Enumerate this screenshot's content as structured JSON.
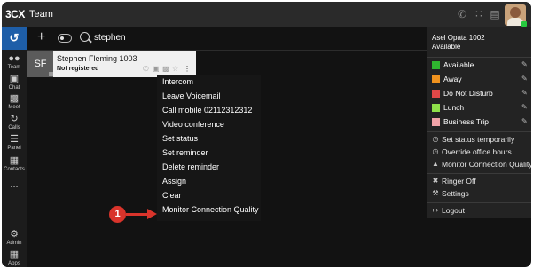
{
  "window": {
    "logo": "3CX",
    "title": "Team"
  },
  "sidebar": {
    "items": [
      {
        "label": "Team",
        "icon": "people-icon"
      },
      {
        "label": "Chat",
        "icon": "chat-icon"
      },
      {
        "label": "Meet",
        "icon": "video-icon"
      },
      {
        "label": "Calls",
        "icon": "history-icon"
      },
      {
        "label": "Panel",
        "icon": "panel-icon"
      },
      {
        "label": "Contacts",
        "icon": "contacts-icon"
      },
      {
        "label": "...",
        "icon": "more-icon"
      },
      {
        "label": "Admin",
        "icon": "gear-icon"
      },
      {
        "label": "Apps",
        "icon": "apps-icon"
      }
    ]
  },
  "search": {
    "value": "stephen"
  },
  "contact": {
    "initials": "SF",
    "name": "Stephen Fleming 1003",
    "status": "Not registered"
  },
  "context_menu": {
    "items": [
      "Intercom",
      "Leave Voicemail",
      "Call mobile 02112312312",
      "Video conference",
      "Set status",
      "Set reminder",
      "Delete reminder",
      "Assign",
      "Clear",
      "Monitor Connection Quality"
    ]
  },
  "callout": {
    "number": "1",
    "color": "#d9342b"
  },
  "status_panel": {
    "user": "Asel Opata  1002",
    "current": "Available",
    "statuses": [
      {
        "label": "Available",
        "color": "#2fb52f"
      },
      {
        "label": "Away",
        "color": "#f0921e"
      },
      {
        "label": "Do Not Disturb",
        "color": "#e04848"
      },
      {
        "label": "Lunch",
        "color": "#8fe04a"
      },
      {
        "label": "Business Trip",
        "color": "#f1a3a8"
      }
    ],
    "options": [
      {
        "label": "Set status temporarily",
        "icon": "clock-icon"
      },
      {
        "label": "Override office hours",
        "icon": "clock-icon"
      },
      {
        "label": "Monitor Connection Quality",
        "icon": "signal-icon"
      }
    ],
    "settings": [
      {
        "label": "Ringer Off",
        "icon": "bell-off-icon"
      },
      {
        "label": "Settings",
        "icon": "wrench-icon"
      }
    ],
    "logout": {
      "label": "Logout",
      "icon": "logout-icon"
    }
  }
}
